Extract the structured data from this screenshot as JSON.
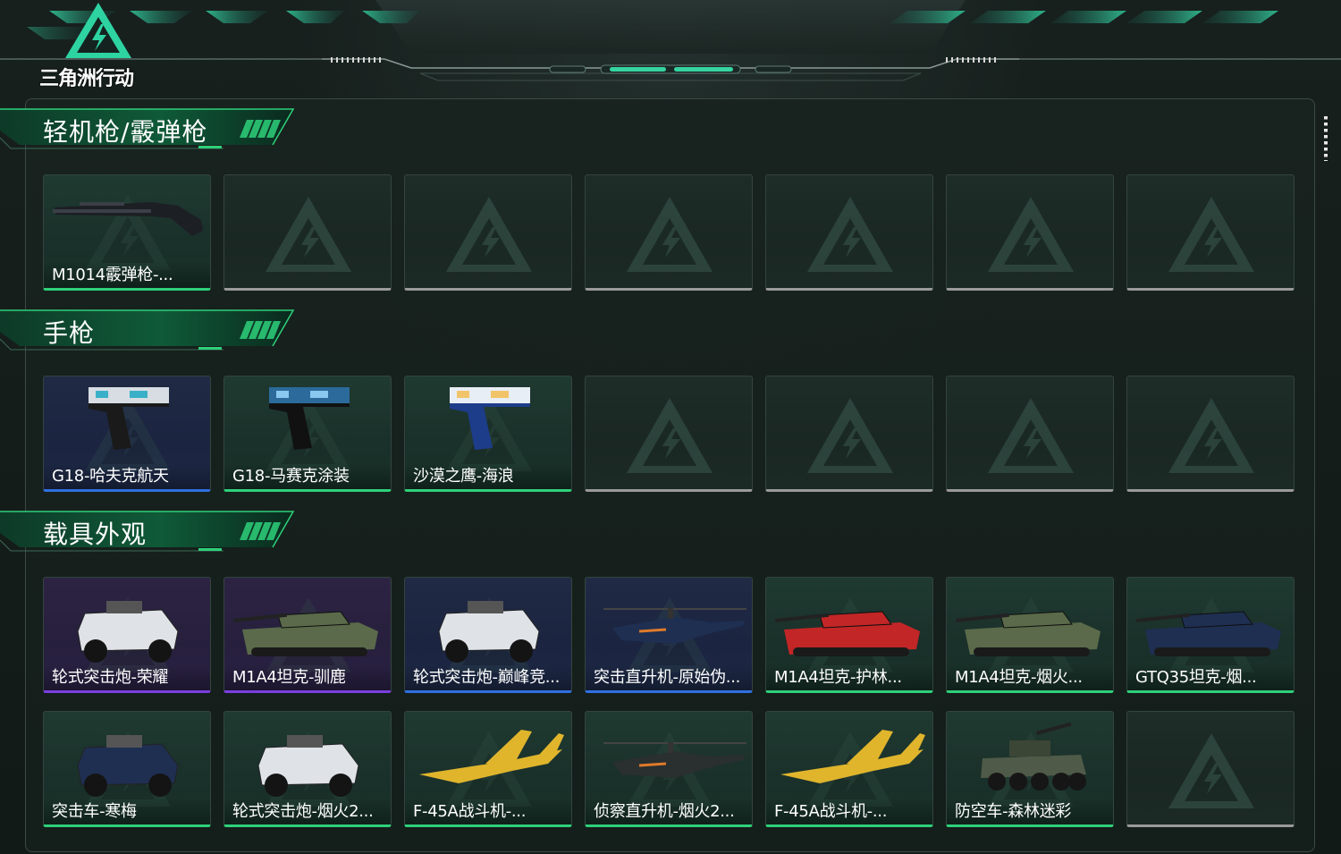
{
  "app": {
    "logo_text": "三角洲行动"
  },
  "colors": {
    "accent_green": "#2ed07a",
    "rarity_blue": "#2f6fe0",
    "rarity_purple": "#7a3fe0",
    "empty_border": "#9a9a9a"
  },
  "sections": [
    {
      "title": "轻机枪/霰弹枪",
      "items": [
        {
          "label": "M1014霰弹枪-...",
          "rarity": "green",
          "icon": "shotgun-icon"
        },
        {
          "label": "",
          "rarity": "empty"
        },
        {
          "label": "",
          "rarity": "empty"
        },
        {
          "label": "",
          "rarity": "empty"
        },
        {
          "label": "",
          "rarity": "empty"
        },
        {
          "label": "",
          "rarity": "empty"
        },
        {
          "label": "",
          "rarity": "empty"
        }
      ]
    },
    {
      "title": "手枪",
      "items": [
        {
          "label": "G18-哈夫克航天",
          "rarity": "blue",
          "icon": "pistol-icon"
        },
        {
          "label": "G18-马赛克涂装",
          "rarity": "green",
          "icon": "pistol-icon"
        },
        {
          "label": "沙漠之鹰-海浪",
          "rarity": "green",
          "icon": "pistol-icon"
        },
        {
          "label": "",
          "rarity": "empty"
        },
        {
          "label": "",
          "rarity": "empty"
        },
        {
          "label": "",
          "rarity": "empty"
        },
        {
          "label": "",
          "rarity": "empty"
        }
      ]
    },
    {
      "title": "载具外观",
      "items": [
        {
          "label": "轮式突击炮-荣耀",
          "rarity": "purple",
          "icon": "armored-car-icon"
        },
        {
          "label": "M1A4坦克-驯鹿",
          "rarity": "purple",
          "icon": "tank-icon"
        },
        {
          "label": "轮式突击炮-巅峰竞...",
          "rarity": "blue",
          "icon": "armored-car-icon"
        },
        {
          "label": "突击直升机-原始伪...",
          "rarity": "blue",
          "icon": "helicopter-icon"
        },
        {
          "label": "M1A4坦克-护林...",
          "rarity": "green",
          "icon": "tank-icon"
        },
        {
          "label": "M1A4坦克-烟火...",
          "rarity": "green",
          "icon": "tank-icon"
        },
        {
          "label": "GTQ35坦克-烟...",
          "rarity": "green",
          "icon": "tank-icon"
        },
        {
          "label": "突击车-寒梅",
          "rarity": "green",
          "icon": "armored-car-icon"
        },
        {
          "label": "轮式突击炮-烟火2...",
          "rarity": "green",
          "icon": "armored-car-icon"
        },
        {
          "label": "F-45A战斗机-...",
          "rarity": "green",
          "icon": "jet-icon"
        },
        {
          "label": "侦察直升机-烟火2...",
          "rarity": "green",
          "icon": "helicopter-icon"
        },
        {
          "label": "F-45A战斗机-...",
          "rarity": "green",
          "icon": "jet-icon"
        },
        {
          "label": "防空车-森林迷彩",
          "rarity": "green",
          "icon": "aa-vehicle-icon"
        },
        {
          "label": "",
          "rarity": "empty"
        }
      ]
    }
  ]
}
